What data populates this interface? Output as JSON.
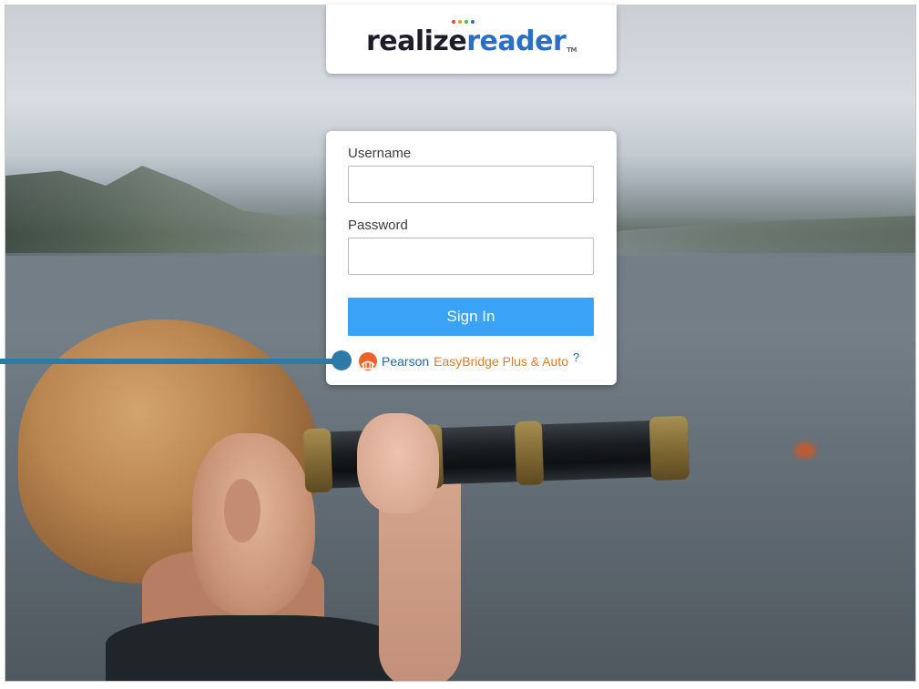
{
  "logo": {
    "part1": "realize",
    "part2": "reader",
    "trademark": "TM",
    "dot_colors": [
      "#e8473e",
      "#f39a2b",
      "#4db552",
      "#2b6fc5"
    ]
  },
  "login": {
    "username_label": "Username",
    "username_value": "",
    "password_label": "Password",
    "password_value": "",
    "sign_in_label": "Sign In"
  },
  "easybridge": {
    "brand": "Pearson",
    "name": "EasyBridge Plus & Auto",
    "help": "?"
  },
  "colors": {
    "accent": "#3aa3f7",
    "callout": "#2b7aa8",
    "easybridge_orange": "#e07b2c",
    "pearson_blue": "#2465a8"
  }
}
